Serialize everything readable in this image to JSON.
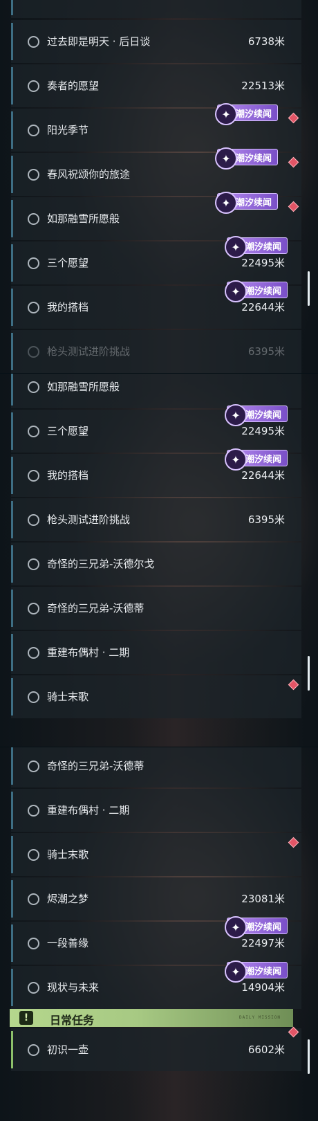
{
  "badge_label": "潮汐续闻",
  "section": {
    "label": "日常任务",
    "tag": "DAILY MISSION"
  },
  "panel1": [
    {
      "title": "过去即是明天 · 后日谈",
      "distance": "6738米"
    },
    {
      "title": "奏者的愿望",
      "distance": "22513米"
    },
    {
      "title": "阳光季节",
      "distance": ""
    },
    {
      "title": "春风祝颂你的旅途",
      "distance": ""
    },
    {
      "title": "如那融雪所愿般",
      "distance": ""
    },
    {
      "title": "三个愿望",
      "distance": "22495米"
    },
    {
      "title": "我的搭档",
      "distance": "22644米"
    },
    {
      "title": "枪头测试进阶挑战",
      "distance": "6395米"
    }
  ],
  "panel2": [
    {
      "title": "如那融雪所愿般",
      "distance": ""
    },
    {
      "title": "三个愿望",
      "distance": "22495米"
    },
    {
      "title": "我的搭档",
      "distance": "22644米"
    },
    {
      "title": "枪头测试进阶挑战",
      "distance": "6395米"
    },
    {
      "title": "奇怪的三兄弟-沃德尔戈",
      "distance": ""
    },
    {
      "title": "奇怪的三兄弟-沃德蒂",
      "distance": ""
    },
    {
      "title": "重建布偶村 · 二期",
      "distance": ""
    },
    {
      "title": "骑士末歌",
      "distance": ""
    }
  ],
  "panel3": [
    {
      "title": "奇怪的三兄弟-沃德蒂",
      "distance": ""
    },
    {
      "title": "重建布偶村 · 二期",
      "distance": ""
    },
    {
      "title": "骑士末歌",
      "distance": ""
    },
    {
      "title": "烬潮之梦",
      "distance": "23081米"
    },
    {
      "title": "一段善缘",
      "distance": "22497米"
    },
    {
      "title": "现状与未来",
      "distance": "14904米"
    },
    {
      "title": "初识一壶",
      "distance": "6602米"
    }
  ],
  "colors": {
    "accent_blue": "#3e6e84",
    "daily_green": "#b5d78d",
    "badge_purple": "#9a6ae0",
    "marker_red": "#e25566"
  }
}
